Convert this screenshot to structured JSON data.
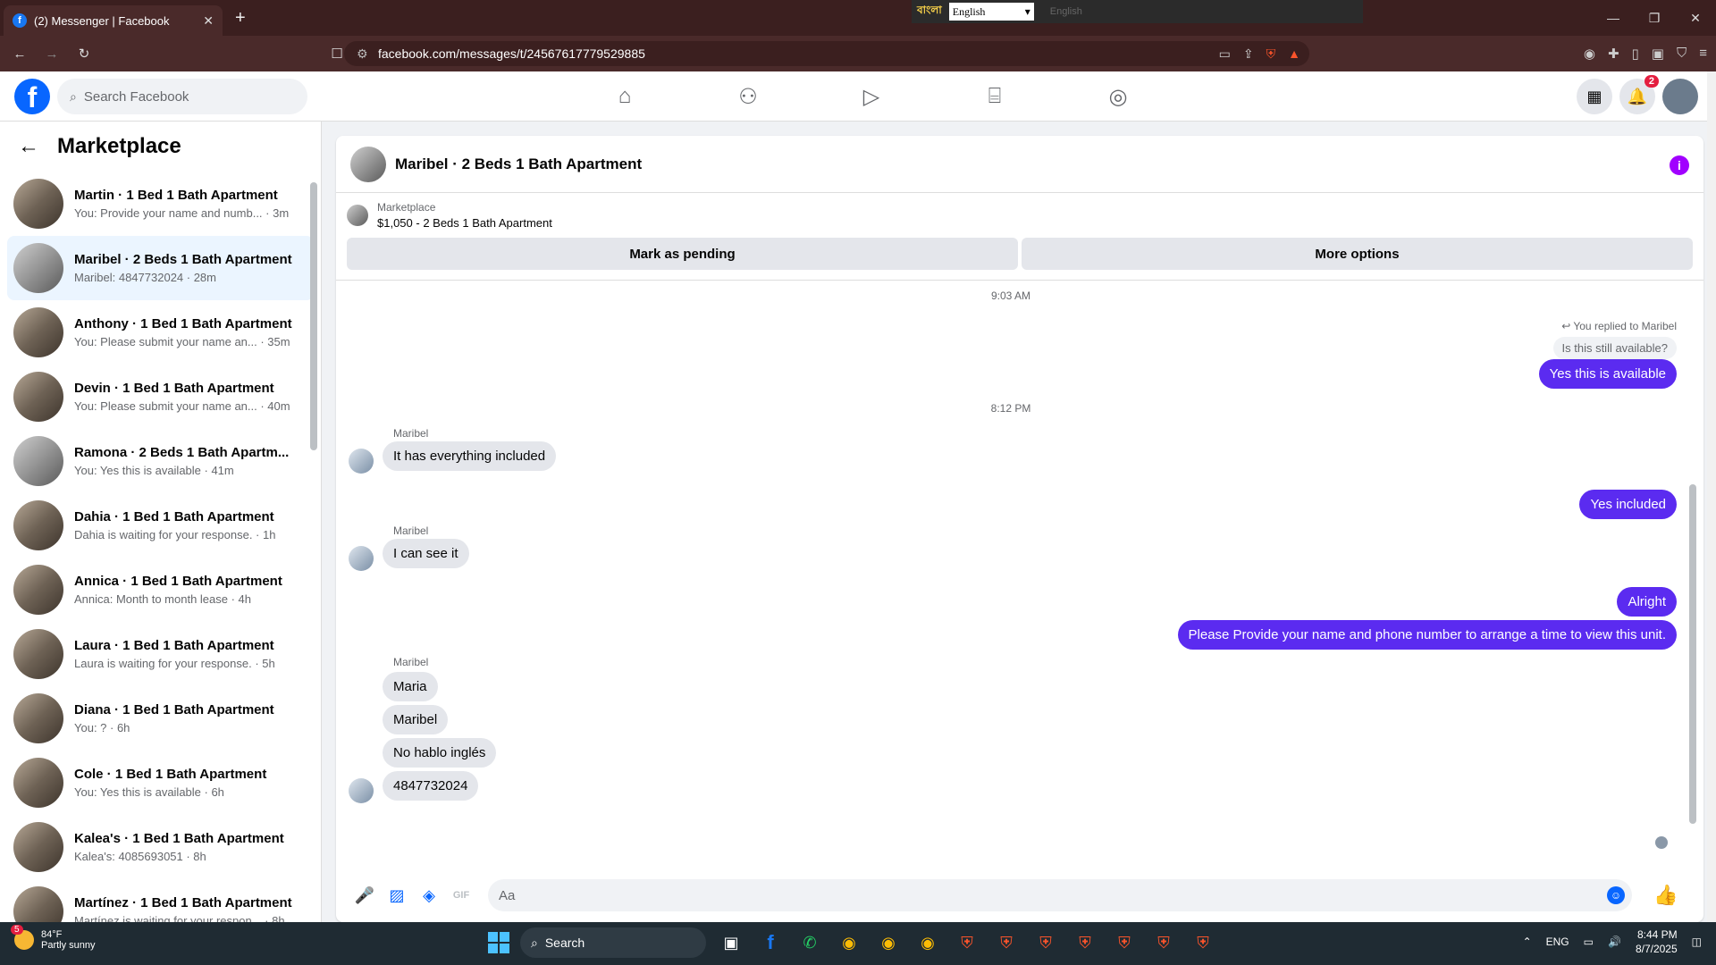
{
  "browser": {
    "tab_title": "(2) Messenger | Facebook",
    "new_tab": "+",
    "tab_close": "✕",
    "url": "facebook.com/messages/t/24567617779529885",
    "lang_bn": "বাংলা",
    "lang_select": "English",
    "lang_dim": "English",
    "win_min": "—",
    "win_max": "❐",
    "win_close": "✕"
  },
  "fb": {
    "search_placeholder": "Search Facebook",
    "notif_count": "2"
  },
  "sidebar": {
    "title": "Marketplace",
    "conversations": [
      {
        "title": "Martin · 1 Bed 1 Bath Apartment",
        "preview": "You: Provide your name and numb... · 3m"
      },
      {
        "title": "Maribel · 2 Beds 1 Bath Apartment",
        "preview": "Maribel: 4847732024 · 28m"
      },
      {
        "title": "Anthony · 1 Bed 1 Bath Apartment",
        "preview": "You: Please submit your name an... · 35m"
      },
      {
        "title": "Devin · 1 Bed 1 Bath Apartment",
        "preview": "You: Please submit your name an... · 40m"
      },
      {
        "title": "Ramona · 2 Beds 1 Bath Apartm...",
        "preview": "You: Yes this is available · 41m"
      },
      {
        "title": "Dahia · 1 Bed 1 Bath Apartment",
        "preview": "Dahia is waiting for your response. · 1h"
      },
      {
        "title": "Annica · 1 Bed 1 Bath Apartment",
        "preview": "Annica: Month to month lease · 4h"
      },
      {
        "title": "Laura · 1 Bed 1 Bath Apartment",
        "preview": "Laura is waiting for your response. · 5h"
      },
      {
        "title": "Diana · 1 Bed 1 Bath Apartment",
        "preview": "You: ? · 6h"
      },
      {
        "title": "Cole · 1 Bed 1 Bath Apartment",
        "preview": "You: Yes this is available · 6h"
      },
      {
        "title": "Kalea's · 1 Bed 1 Bath Apartment",
        "preview": "Kalea's: 4085693051 · 8h"
      },
      {
        "title": "Martínez · 1 Bed 1 Bath Apartment",
        "preview": "Martínez is waiting for your respon... · 8h"
      }
    ]
  },
  "chat": {
    "title": "Maribel · 2 Beds 1 Bath Apartment",
    "mp_label": "Marketplace",
    "listing": "$1,050 - 2 Beds 1 Bath Apartment",
    "btn_pending": "Mark as pending",
    "btn_more": "More options",
    "ts1": "9:03 AM",
    "replied": "You replied to Maribel",
    "quoted": "Is this still available?",
    "out1": "Yes this is available",
    "ts2": "8:12 PM",
    "sender": "Maribel",
    "in1": "It has everything included",
    "out2": "Yes included",
    "in2": "I can see it",
    "out3": "Alright",
    "out4": "Please Provide your name and phone number to arrange a time to view this unit.",
    "in3": "Maria",
    "in4": "Maribel",
    "in5": "No hablo inglés",
    "in6": "4847732024",
    "composer_placeholder": "Aa",
    "gif": "GIF"
  },
  "taskbar": {
    "temp": "84°F",
    "weather": "Partly sunny",
    "weather_badge": "5",
    "search": "Search",
    "lang": "ENG",
    "time": "8:44 PM",
    "date": "8/7/2025"
  }
}
